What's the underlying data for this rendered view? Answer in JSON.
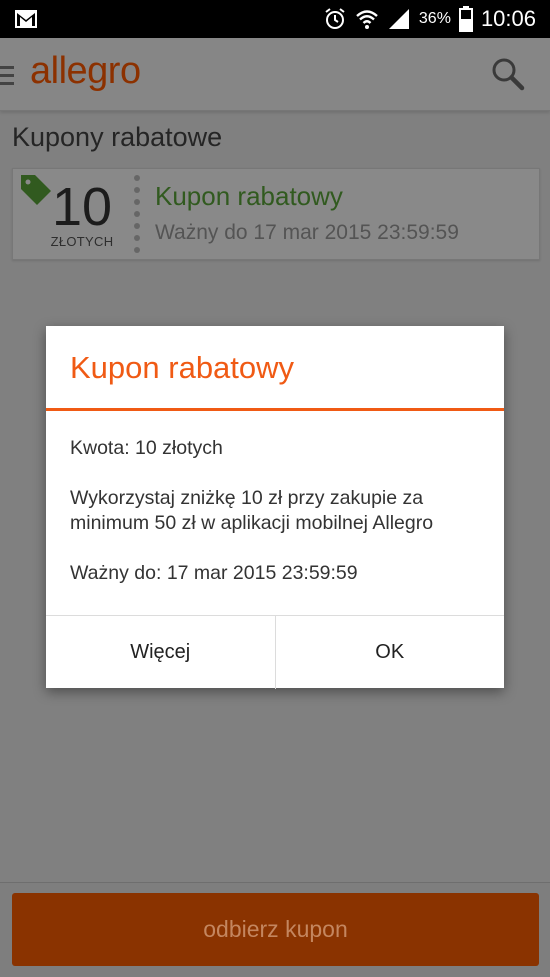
{
  "status_bar": {
    "battery_percent": "36%",
    "time": "10:06",
    "icons": [
      "gmail-icon",
      "alarm-icon",
      "wifi-icon",
      "signal-icon",
      "battery-icon"
    ]
  },
  "app_bar": {
    "logo": "allegro",
    "icons": [
      "menu-icon",
      "search-icon"
    ]
  },
  "page": {
    "title": "Kupony rabatowe"
  },
  "coupon": {
    "amount": "10",
    "unit": "ZŁOTYCH",
    "title": "Kupon rabatowy",
    "valid": "Ważny do 17 mar 2015 23:59:59"
  },
  "dialog": {
    "title": "Kupon rabatowy",
    "amount_line": "Kwota: 10 złotych",
    "description": "Wykorzystaj zniżkę 10 zł przy zakupie za minimum 50 zł w aplikacji mobilnej Allegro",
    "valid_line": "Ważny do: 17 mar 2015 23:59:59",
    "more_button": "Więcej",
    "ok_button": "OK"
  },
  "bottom_button": {
    "label": "odbierz kupon"
  },
  "colors": {
    "brand": "#ff5a00",
    "dialog_accent": "#f05a14",
    "coupon_title": "#5aa43a"
  }
}
